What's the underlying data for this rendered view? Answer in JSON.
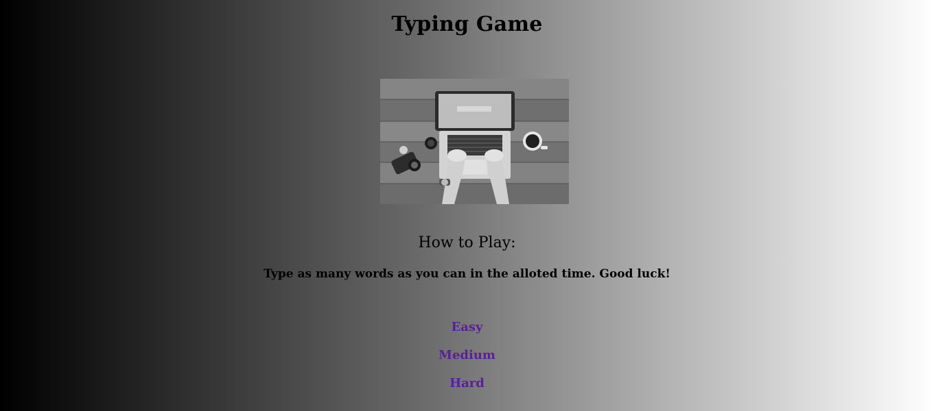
{
  "page": {
    "title": "Typing Game",
    "image_alt": "laptop-typing-photo"
  },
  "instructions": {
    "heading": "How to Play:",
    "text": "Type as many words as you can in the alloted time. Good luck!"
  },
  "difficulty": {
    "levels": [
      {
        "label": "Easy"
      },
      {
        "label": "Medium"
      },
      {
        "label": "Hard"
      }
    ],
    "link_color": "#5a1f9a"
  }
}
